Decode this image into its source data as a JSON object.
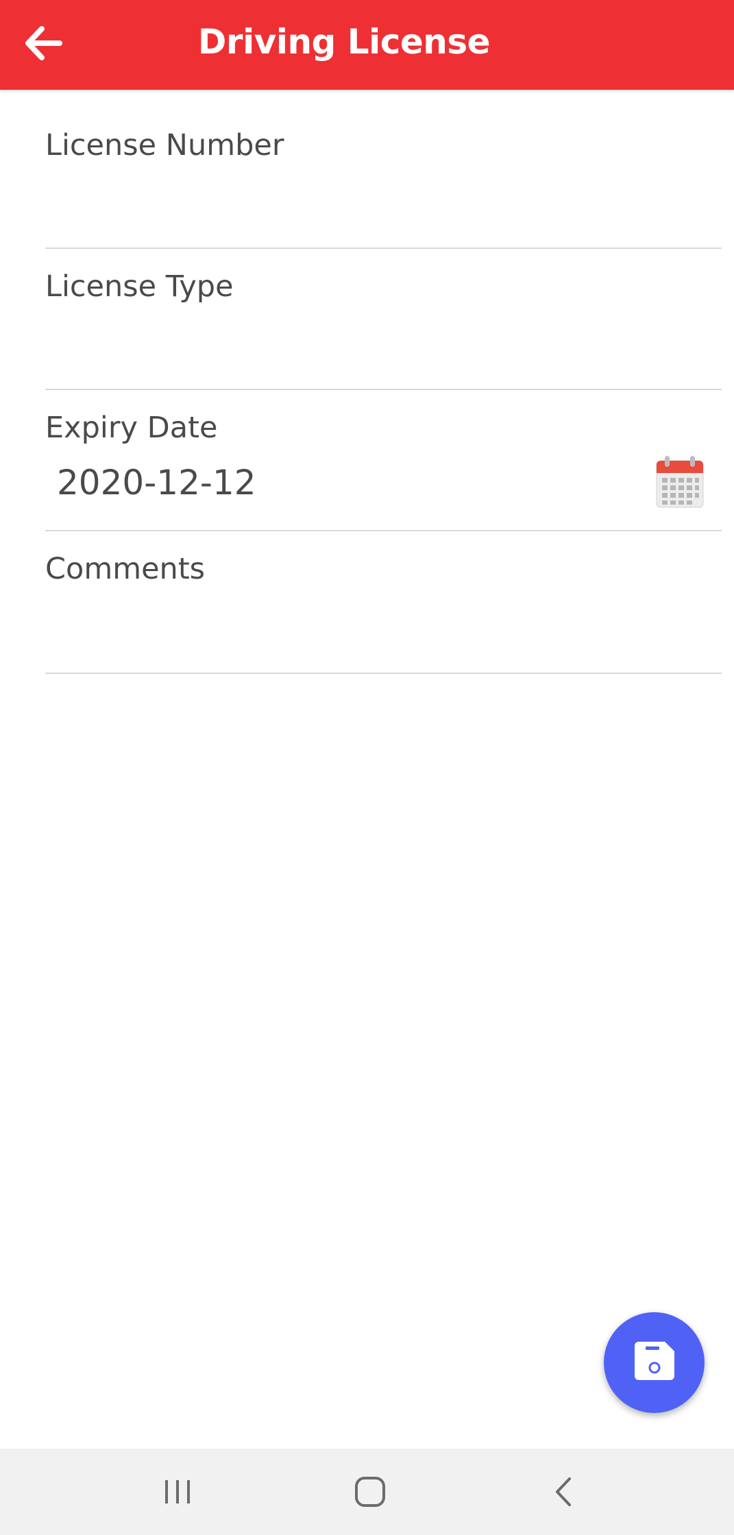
{
  "header": {
    "title": "Driving License",
    "back_icon": "arrow-left-icon",
    "color": "#ee3035"
  },
  "form": {
    "license_number": {
      "label": "License Number",
      "value": ""
    },
    "license_type": {
      "label": "License Type",
      "value": ""
    },
    "expiry_date": {
      "label": "Expiry Date",
      "value": "2020-12-12",
      "picker_icon": "calendar-icon"
    },
    "comments": {
      "label": "Comments",
      "value": ""
    }
  },
  "fab": {
    "icon": "save-icon",
    "color": "#4f62f5"
  },
  "navbar": {
    "recents_icon": "recents-icon",
    "home_icon": "home-icon",
    "back_icon": "back-chevron-icon"
  }
}
